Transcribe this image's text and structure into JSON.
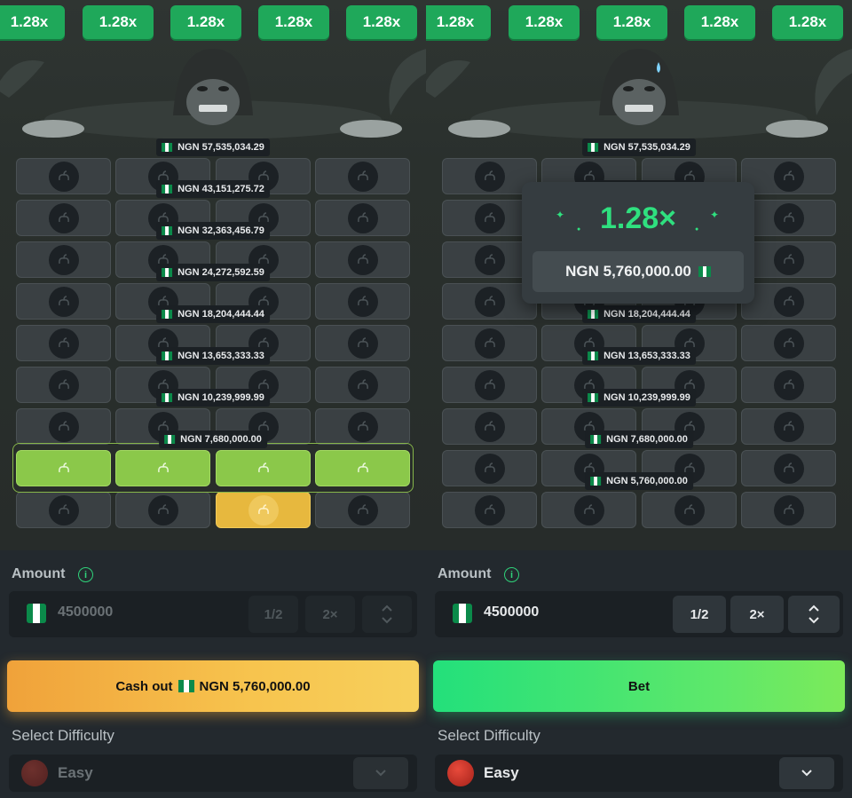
{
  "multipliers": [
    "1.28x",
    "1.28x",
    "1.28x",
    "1.28x",
    "1.28x"
  ],
  "prize_ladder": [
    "NGN 57,535,034.29",
    "NGN 43,151,275.72",
    "NGN 32,363,456.79",
    "NGN 24,272,592.59",
    "NGN 18,204,444.44",
    "NGN 13,653,333.33",
    "NGN 10,239,999.99",
    "NGN 7,680,000.00",
    "NGN 5,760,000.00"
  ],
  "left": {
    "amount_label": "Amount",
    "amount_value": "4500000",
    "half_label": "1/2",
    "double_label": "2×",
    "cashout_label": "Cash out",
    "cashout_amount": "NGN 5,760,000.00",
    "difficulty_label": "Select Difficulty",
    "difficulty_value": "Easy"
  },
  "right": {
    "amount_label": "Amount",
    "amount_value": "4500000",
    "half_label": "1/2",
    "double_label": "2×",
    "bet_label": "Bet",
    "difficulty_label": "Select Difficulty",
    "difficulty_value": "Easy",
    "popup_multiplier": "1.28×",
    "popup_amount": "NGN 5,760,000.00"
  },
  "info_icon_text": "i",
  "colors": {
    "accent_green": "#1fa85a",
    "win_text": "#2fe07f",
    "revealed_tile": "#8bc84a",
    "selected_tile": "#e7b83e",
    "cashout_button": "#f0a23a",
    "bet_button": "#23e07b"
  }
}
